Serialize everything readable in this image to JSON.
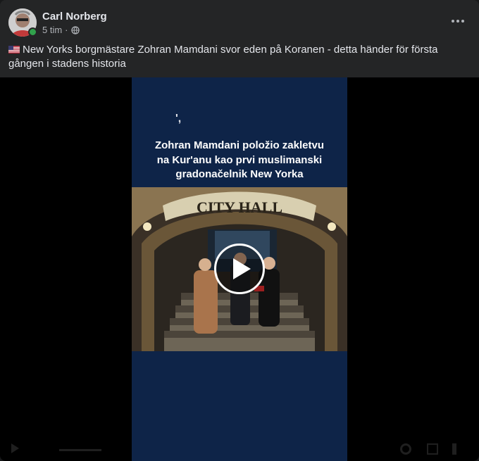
{
  "post": {
    "author": "Carl Norberg",
    "time": "5 tim",
    "separator": "·",
    "audience_icon": "globe-icon",
    "more_icon": "more-horizontal-icon",
    "flag_icon": "us-flag-icon",
    "text": "New Yorks borgmästare Zohran Mamdani svor eden på Koranen - detta händer för första gången i stadens historia"
  },
  "video": {
    "corner_mark": "',",
    "overlay_title_lines": [
      "Zohran Mamdani položio zakletvu",
      "na Kur'anu kao prvi muslimanski",
      "gradonačelnik New Yorka"
    ],
    "sign_text": "CITY HALL",
    "play_icon": "play-icon"
  },
  "colors": {
    "card_bg": "#242526",
    "video_bg": "#0e2448",
    "online": "#31a24c",
    "text_primary": "#e4e6eb",
    "text_secondary": "#b0b3b8"
  }
}
